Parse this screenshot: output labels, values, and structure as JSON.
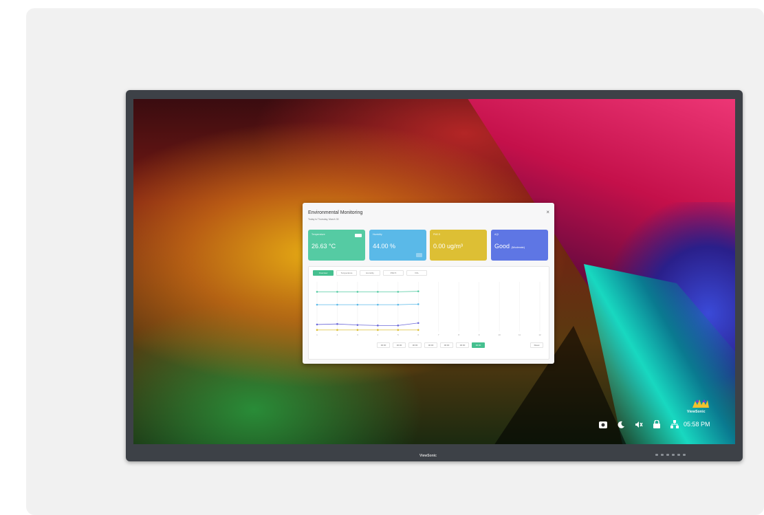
{
  "device": {
    "bezel_brand": "ViewSonic",
    "screen_logo_text": "ViewSonic"
  },
  "dialog": {
    "title": "Environmental Monitoring",
    "subtitle": "Today is Thursday, March 30",
    "close_icon": "×",
    "tiles": [
      {
        "label": "Temperature",
        "value": "26.63 °C",
        "color": "#55cba3"
      },
      {
        "label": "Humidity",
        "value": "44.00 %",
        "color": "#5ab9e8"
      },
      {
        "label": "PM2.5",
        "value": "0.00 ug/m³",
        "color": "#ddbf34"
      },
      {
        "label": "AQI",
        "value": "Good",
        "value_suffix": "(Moderate)",
        "color": "#5e76e4"
      }
    ],
    "tabs": [
      "Overview",
      "Temperature",
      "Humidity",
      "PM2.5",
      "VOL"
    ],
    "active_tab": 0,
    "time_buttons": [
      "00:00",
      "00:00",
      "00:00",
      "00:00",
      "00:00",
      "00:00",
      "00:00"
    ],
    "active_time_button": 6,
    "reset_label": "Reset"
  },
  "chart_data": {
    "type": "line",
    "categories": [
      "1",
      "2",
      "3",
      "4",
      "5",
      "6",
      "7",
      "8",
      "9",
      "10",
      "11",
      "12"
    ],
    "series": [
      {
        "values": [
          80,
          80,
          80,
          80,
          80,
          81
        ],
        "color": "#55cba3"
      },
      {
        "values": [
          54,
          54,
          54,
          54,
          54,
          55
        ],
        "color": "#5ab9e8"
      },
      {
        "values": [
          14,
          15,
          13,
          12,
          12,
          17
        ],
        "color": "#6b68d8"
      },
      {
        "values": [
          3,
          3,
          3,
          3,
          3,
          3
        ],
        "color": "#ddbf34"
      }
    ],
    "ylim": [
      0,
      100
    ],
    "grid": "vertical"
  },
  "taskbar": {
    "icons": [
      "camera-icon",
      "moon-icon",
      "mute-icon",
      "lock-icon",
      "network-icon"
    ],
    "clock": "05:58 PM"
  }
}
